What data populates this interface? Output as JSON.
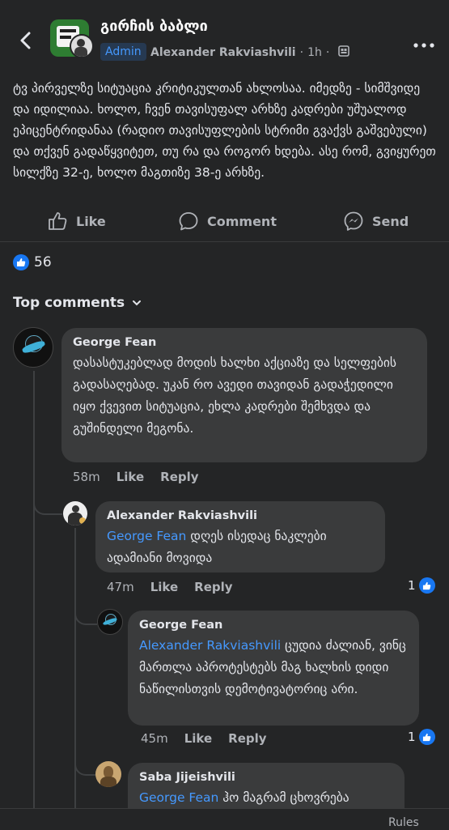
{
  "header": {
    "group_name": "გირჩის ბაბლი",
    "admin_badge": "Admin",
    "author": "Alexander Rakviashvili",
    "time": "1h",
    "separator": "·",
    "icons": [
      "back-arrow-icon",
      "group-privacy-icon",
      "more-dots-icon"
    ]
  },
  "post": {
    "text": "ტვ პირველზე სიტუაცია კრიტიკულთან ახლოსაა. იმედზე - სიმშვიდე და იდილიაა. ხოლო, ჩვენ თავისუფალ არხზე კადრები უშუალოდ ეპიცენტრიდანაა (რადიო თავისუფლების სტრიმი გვაქვს გაშვებული) და თქვენ გადაწყვიტეთ, თუ რა და როგორ ხდება. ასე რომ, გვიყურეთ სილქზე 32-ე, ხოლო მაგთიზე 38-ე არხზე."
  },
  "actions": {
    "like": "Like",
    "comment": "Comment",
    "send": "Send"
  },
  "reactions": {
    "count": "56"
  },
  "comments_header": {
    "label": "Top comments"
  },
  "comments": [
    {
      "author": "George Fean",
      "text": "დასასტუკებლად მოდის ხალხი აქციაზე და სელფების გადასაღებად. უკან რო ავედი თავიდან გადაჭედილი იყო ქვევით სიტუაცია, ეხლა კადრები შემხვდა და გუშინდელი მეგონა.",
      "time": "58m",
      "like": "Like",
      "reply": "Reply"
    },
    {
      "author": "Alexander Rakviashvili",
      "mention": "George Fean",
      "text": " დღეს ისედაც ნაკლები ადამიანი მოვიდა",
      "time": "47m",
      "like": "Like",
      "reply": "Reply",
      "reactions": "1"
    },
    {
      "author": "George Fean",
      "mention": "Alexander Rakviashvili",
      "text": " ცუდია ძალიან, ვინც მართლა აპროტესტებს მაგ ხალხის დიდი ნაწილისთვის დემოტივატორიც არი.",
      "time": "45m",
      "like": "Like",
      "reply": "Reply",
      "reactions": "1"
    },
    {
      "author": "Saba Jijeishvili",
      "mention": "George Fean",
      "text": " ჰო მაგრამ ცხოვრება"
    }
  ],
  "footer": {
    "rules": "Rules"
  },
  "colors": {
    "background": "#242526",
    "bubble": "#3a3b3c",
    "accent": "#1877f2",
    "mention": "#4599ff",
    "muted": "#b0b3b8"
  }
}
